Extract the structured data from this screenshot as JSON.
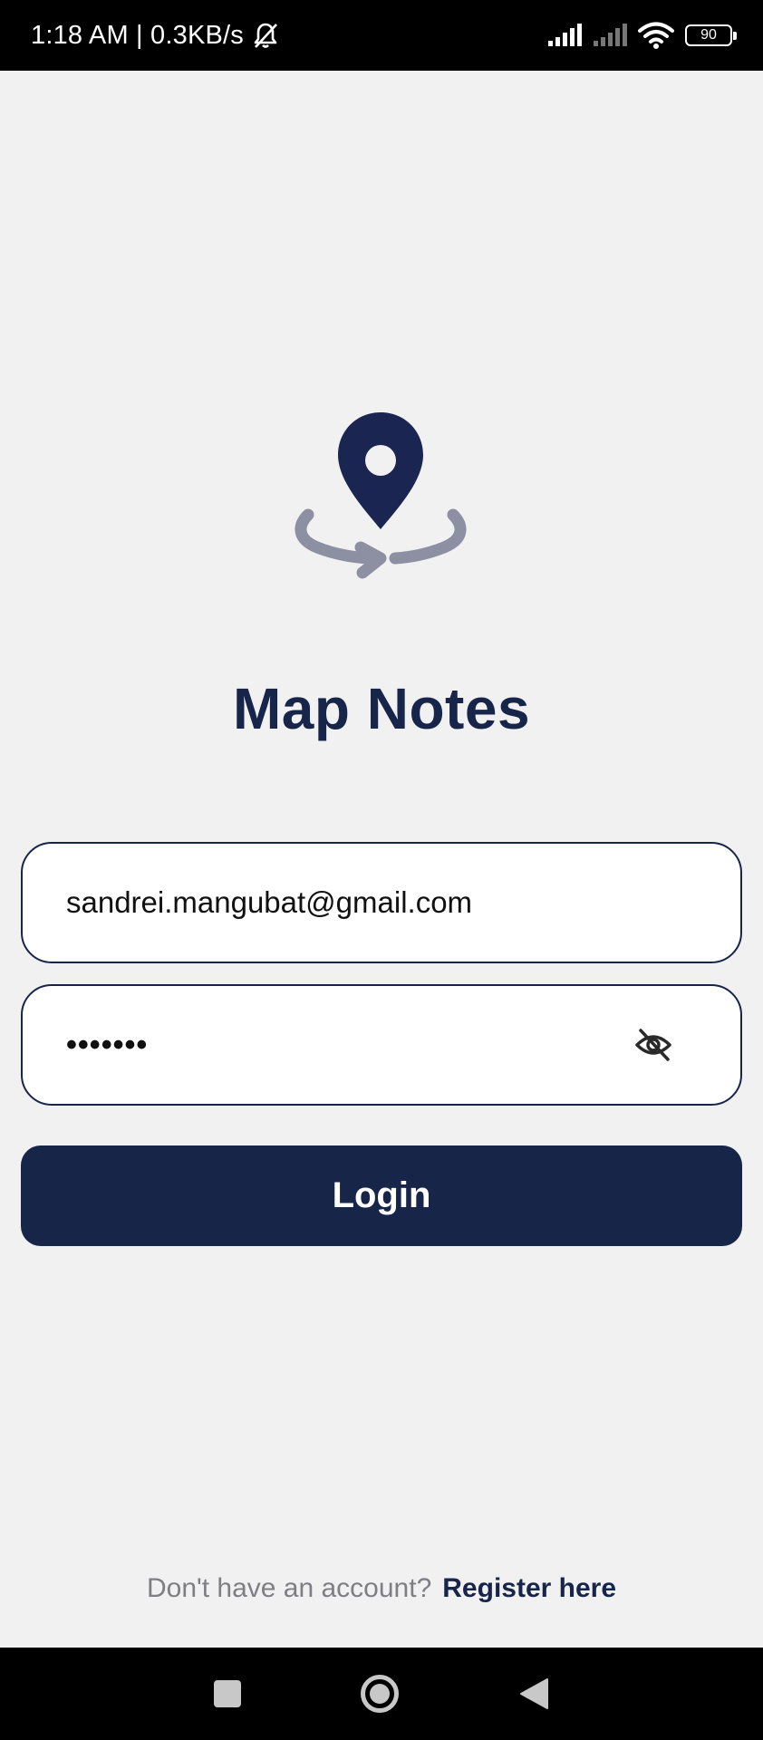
{
  "status_bar": {
    "time_speed": "1:18 AM | 0.3KB/s",
    "battery_level": "90"
  },
  "app": {
    "title": "Map Notes",
    "logo_icon": "location-pin-rotate-icon",
    "colors": {
      "primary": "#17254a",
      "logo_arc": "#8c90a2",
      "background": "#f1f1f2"
    }
  },
  "login_form": {
    "email_value": "sandrei.mangubat@gmail.com",
    "password_masked": "•••••••",
    "password_toggle_icon": "eye-slash-icon",
    "login_label": "Login"
  },
  "register": {
    "prompt": "Don't have an account?",
    "link_label": "Register here"
  },
  "nav_bar": {
    "icons": [
      "recent-apps-icon",
      "home-icon",
      "back-icon"
    ]
  }
}
